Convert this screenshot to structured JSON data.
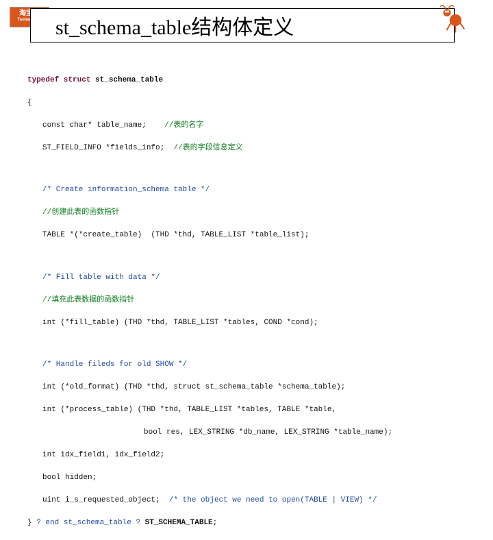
{
  "logo": {
    "line1": "淘宝网",
    "line2": "Taobao.com"
  },
  "title": "st_schema_table结构体定义",
  "code": {
    "l1_kw": "typedef struct",
    "l1_id": " st_schema_table",
    "l2": "{",
    "l3a": "const char* table_name;    ",
    "l3b": "//表的名字",
    "l4a": "ST_FIELD_INFO *fields_info;  ",
    "l4b": "//表的字段信息定义",
    "l5": "/* Create information_schema table */",
    "l6": "//创建此表的函数指针",
    "l7": "TABLE *(*create_table)  (THD *thd, TABLE_LIST *table_list);",
    "l8": "/* Fill table with data */",
    "l9": "//填充此表数据的函数指针",
    "l10": "int (*fill_table) (THD *thd, TABLE_LIST *tables, COND *cond);",
    "l11": "/* Handle fileds for old SHOW */",
    "l12": "int (*old_format) (THD *thd, struct st_schema_table *schema_table);",
    "l13": "int (*process_table) (THD *thd, TABLE_LIST *tables, TABLE *table,",
    "l14": "bool res, LEX_STRING *db_name, LEX_STRING *table_name);",
    "l15": "int idx_field1, idx_field2;",
    "l16": "bool hidden;",
    "l17a": "uint i_s_requested_object;  ",
    "l17b": "/* the object we need to open(TABLE | VIEW) */",
    "l18a": "} ",
    "l18b": "? end st_schema_table ?",
    "l18id": " ST_SCHEMA_TABLE",
    "l18c": ";"
  }
}
